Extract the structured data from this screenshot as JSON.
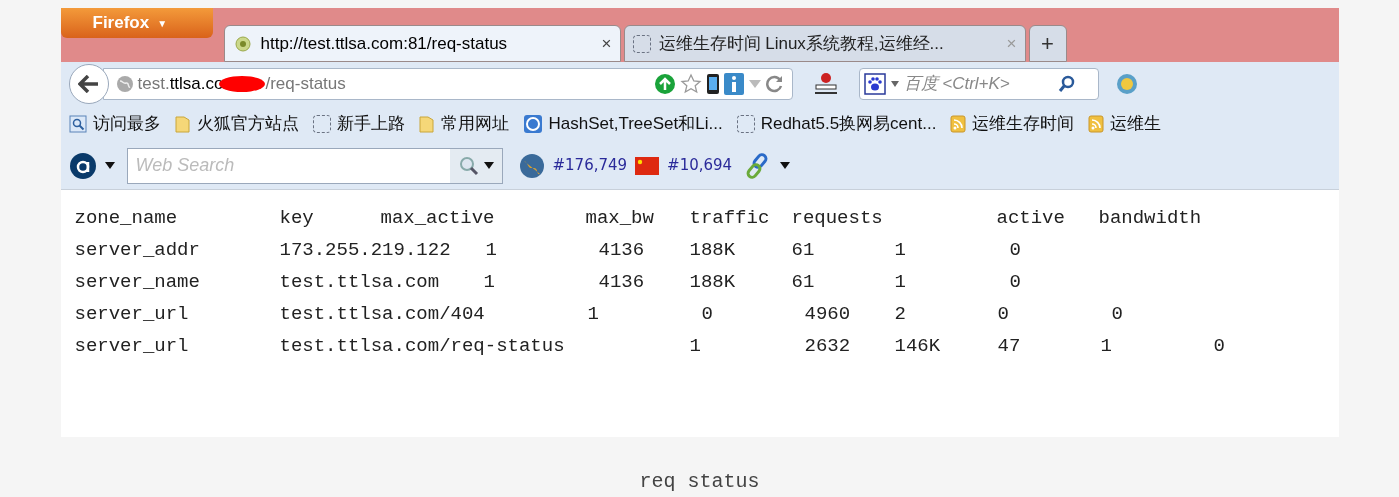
{
  "menu_button": {
    "label": "Firefox",
    "caret": "▼"
  },
  "tabs": [
    {
      "title": "http://test.ttlsa.com:81/req-status",
      "selected": true,
      "close": "×",
      "kind": "site"
    },
    {
      "title": "运维生存时间 Linux系统教程,运维经...",
      "selected": false,
      "close": "×",
      "kind": "blank"
    }
  ],
  "new_tab": "+",
  "address": {
    "start": "test.**ttlsa.co**",
    "end": "/req-status"
  },
  "search": {
    "placeholder": "百度 <Ctrl+K>"
  },
  "bookmarks": [
    {
      "label": "访问最多",
      "kind": "search"
    },
    {
      "label": "火狐官方站点",
      "kind": "folder"
    },
    {
      "label": "新手上路",
      "kind": "blank"
    },
    {
      "label": "常用网址",
      "kind": "folder"
    },
    {
      "label": "HashSet,TreeSet和Li...",
      "kind": "app"
    },
    {
      "label": "Redhat5.5换网易cent...",
      "kind": "blank"
    },
    {
      "label": "运维生存时间",
      "kind": "feed"
    },
    {
      "label": "运维生",
      "kind": "feed"
    }
  ],
  "addon_bar": {
    "placeholder": "Web Search",
    "global_rank": "#176,749",
    "country_rank": "#10,694"
  },
  "status_output": {
    "header": [
      "zone_name",
      "key",
      "max_active",
      "max_bw",
      "traffic",
      "requests",
      "active",
      "bandwidth"
    ],
    "lines": [
      [
        "server_addr",
        "173.255.219.122",
        "1",
        "4136",
        "188K",
        "61",
        "1",
        "0"
      ],
      [
        "server_name",
        "test.ttlsa.com",
        "1",
        "4136",
        "188K",
        "61",
        "1",
        "0"
      ],
      [
        "server_url",
        "test.ttlsa.com/404",
        "1",
        "0",
        "4960",
        "2",
        "0",
        "0"
      ],
      [
        "server_url",
        "test.ttlsa.com/req-status",
        "1",
        "2632",
        "146K",
        "47",
        "1",
        "0"
      ]
    ]
  },
  "caption": "req status"
}
